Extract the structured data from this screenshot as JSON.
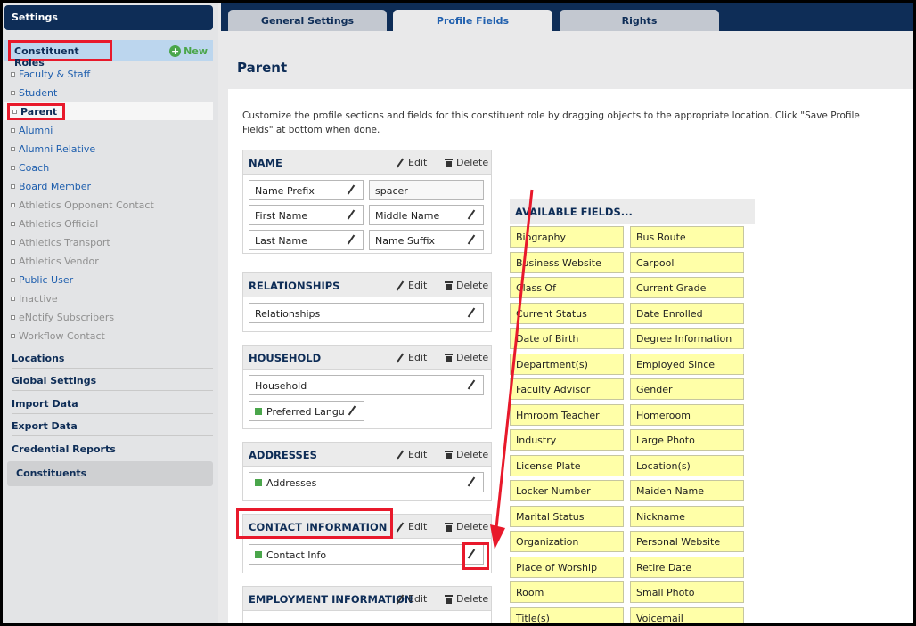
{
  "sidebar": {
    "header": "Settings",
    "roles_title": "Constituent Roles",
    "new_label": "New",
    "roles": [
      {
        "label": "Faculty & Staff",
        "active": true
      },
      {
        "label": "Student",
        "active": true
      },
      {
        "label": "Parent",
        "active": true,
        "selected": true
      },
      {
        "label": "Alumni",
        "active": true
      },
      {
        "label": "Alumni Relative",
        "active": true
      },
      {
        "label": "Coach",
        "active": true
      },
      {
        "label": "Board Member",
        "active": true
      },
      {
        "label": "Athletics Opponent Contact",
        "active": false
      },
      {
        "label": "Athletics Official",
        "active": false
      },
      {
        "label": "Athletics Transport",
        "active": false
      },
      {
        "label": "Athletics Vendor",
        "active": false
      },
      {
        "label": "Public User",
        "active": true
      },
      {
        "label": "Inactive",
        "active": false
      },
      {
        "label": "eNotify Subscribers",
        "active": false
      },
      {
        "label": "Workflow Contact",
        "active": false
      }
    ],
    "links": [
      "Locations",
      "Global Settings",
      "Import Data",
      "Export Data",
      "Credential Reports"
    ],
    "constituents": "Constituents"
  },
  "tabs": [
    {
      "label": "General Settings",
      "active": false
    },
    {
      "label": "Profile Fields",
      "active": true
    },
    {
      "label": "Rights",
      "active": false
    }
  ],
  "page": {
    "title": "Parent",
    "instructions": "Customize the profile sections and fields for this constituent role by dragging objects to the appropriate location. Click \"Save Profile Fields\" at bottom when done."
  },
  "section_actions": {
    "edit": "Edit",
    "delete": "Delete"
  },
  "sections": {
    "name": {
      "title": "NAME",
      "fields": [
        "Name Prefix",
        "spacer",
        "First Name",
        "Middle Name",
        "Last Name",
        "Name Suffix"
      ]
    },
    "relationships": {
      "title": "RELATIONSHIPS",
      "fields": [
        "Relationships"
      ]
    },
    "household": {
      "title": "HOUSEHOLD",
      "fields": [
        "Household",
        "Preferred Langu"
      ]
    },
    "addresses": {
      "title": "ADDRESSES",
      "fields": [
        "Addresses"
      ]
    },
    "contact": {
      "title": "CONTACT INFORMATION",
      "fields": [
        "Contact Info"
      ]
    },
    "employment": {
      "title": "EMPLOYMENT INFORMATION",
      "fields": []
    }
  },
  "available": {
    "title": "AVAILABLE FIELDS...",
    "left": [
      "Biography",
      "Business Website",
      "Class Of",
      "Current Status",
      "Date of Birth",
      "Department(s)",
      "Faculty Advisor",
      "Hmroom Teacher",
      "Industry",
      "License Plate",
      "Locker Number",
      "Marital Status",
      "Organization",
      "Place of Worship",
      "Room",
      "Title(s)"
    ],
    "right": [
      "Bus Route",
      "Carpool",
      "Current Grade",
      "Date Enrolled",
      "Degree Information",
      "Employed Since",
      "Gender",
      "Homeroom",
      "Large Photo",
      "Location(s)",
      "Maiden Name",
      "Nickname",
      "Personal Website",
      "Retire Date",
      "Small Photo",
      "Voicemail"
    ]
  },
  "colors": {
    "navy": "#0e2d57",
    "highlight_red": "#e8192b",
    "available_field": "#ffffa8",
    "new_green": "#4aa64b"
  }
}
